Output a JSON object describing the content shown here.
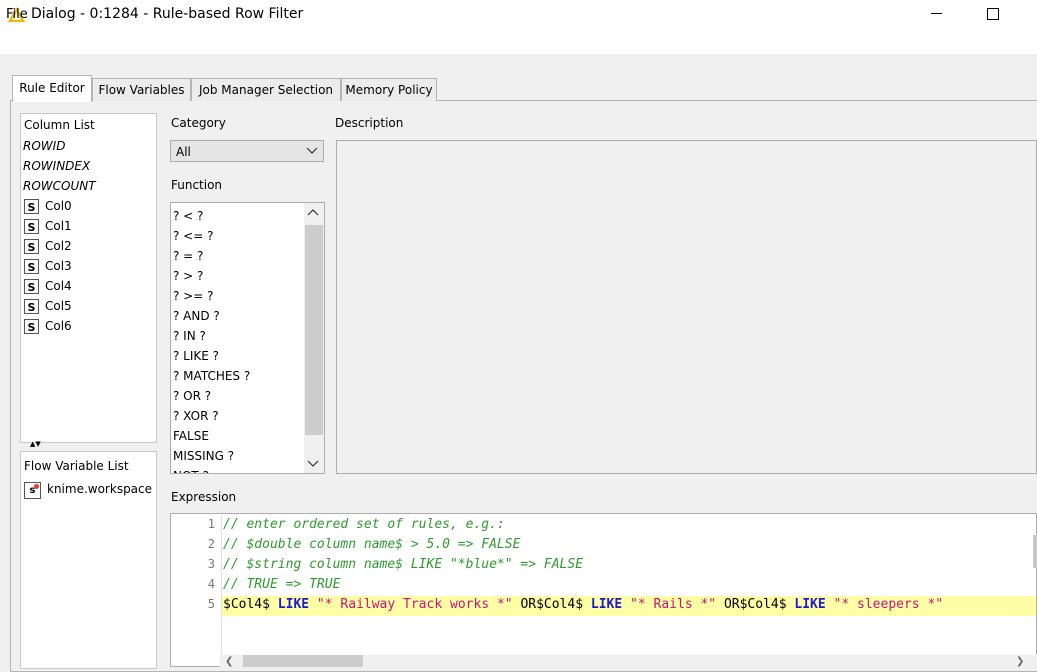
{
  "window": {
    "title": "Dialog - 0:1284 - Rule-based Row Filter"
  },
  "menu": {
    "file": "File"
  },
  "tabs": [
    {
      "label": "Rule Editor",
      "active": true
    },
    {
      "label": "Flow Variables"
    },
    {
      "label": "Job Manager Selection"
    },
    {
      "label": "Memory Policy"
    }
  ],
  "column_list": {
    "header": "Column List",
    "special": [
      "ROWID",
      "ROWINDEX",
      "ROWCOUNT"
    ],
    "type_badge": "S",
    "columns": [
      "Col0",
      "Col1",
      "Col2",
      "Col3",
      "Col4",
      "Col5",
      "Col6"
    ]
  },
  "flow_variable_list": {
    "header": "Flow Variable List",
    "badge": "s",
    "items": [
      "knime.workspace"
    ]
  },
  "category": {
    "label": "Category",
    "value": "All"
  },
  "function": {
    "label": "Function",
    "items": [
      "? < ?",
      "? <= ?",
      "? = ?",
      "? > ?",
      "? >= ?",
      "? AND ?",
      "? IN ?",
      "? LIKE ?",
      "? MATCHES ?",
      "? OR ?",
      "? XOR ?",
      "FALSE",
      "MISSING ?",
      "NOT ?"
    ]
  },
  "description": {
    "label": "Description"
  },
  "expression": {
    "label": "Expression",
    "line_numbers": [
      "1",
      "2",
      "3",
      "4",
      "5"
    ],
    "comment_lines": [
      "// enter ordered set of rules, e.g.:",
      "// $double column name$ > 5.0 => FALSE",
      "// $string column name$ LIKE \"*blue*\" => FALSE",
      "// TRUE => TRUE"
    ],
    "line5": {
      "t1": "$Col4$ ",
      "k1": "LIKE",
      "s1": " \"* Railway Track works *\" ",
      "t2": "OR$Col4$ ",
      "k2": "LIKE",
      "s2": " \"* Rails *\" ",
      "t3": "OR$Col4$ ",
      "k3": "LIKE",
      "s3": " \"* sleepers *\""
    }
  },
  "colors": {
    "highlight": "#ffffa6",
    "comment": "#2f9a2f",
    "keyword": "#1a1ad6",
    "string": "#c8147a"
  }
}
